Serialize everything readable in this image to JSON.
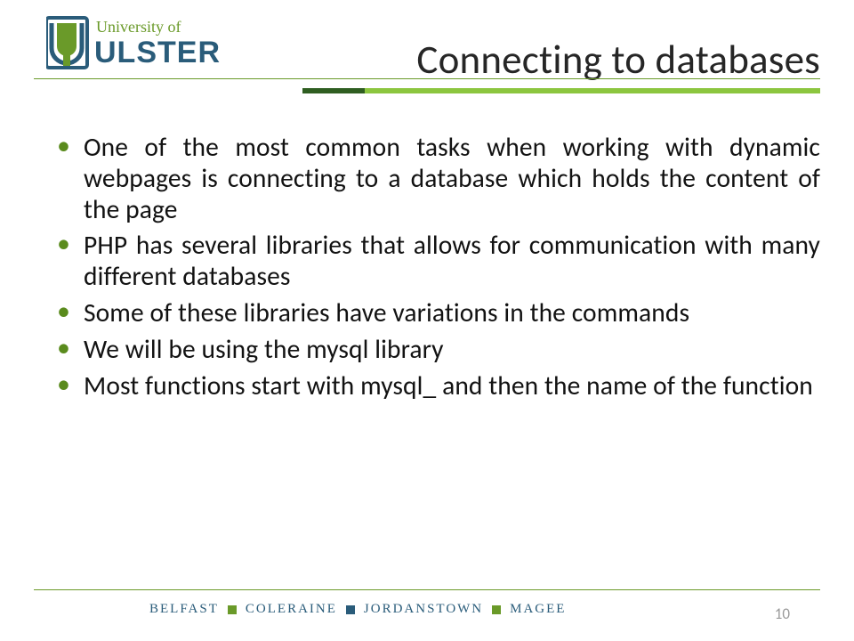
{
  "logo": {
    "line1": "University of",
    "line2": "ULSTER"
  },
  "title": "Connecting to databases",
  "bullets": [
    "One of the most common tasks when working with dynamic webpages is connecting to a database which holds the content of the page",
    "PHP has several libraries that allows for communication with many different databases",
    "Some of these libraries have variations in the commands",
    "We will be using the mysql library",
    "Most functions start with mysql_ and then the name of the function"
  ],
  "footer": {
    "campuses": [
      "BELFAST",
      "COLERAINE",
      "JORDANSTOWN",
      "MAGEE"
    ],
    "page_number": "10"
  },
  "colors": {
    "brand_green": "#6a9a29",
    "brand_dark_green": "#2f5e21",
    "brand_light_green": "#8cc63f",
    "brand_blue": "#2a5c7a"
  }
}
